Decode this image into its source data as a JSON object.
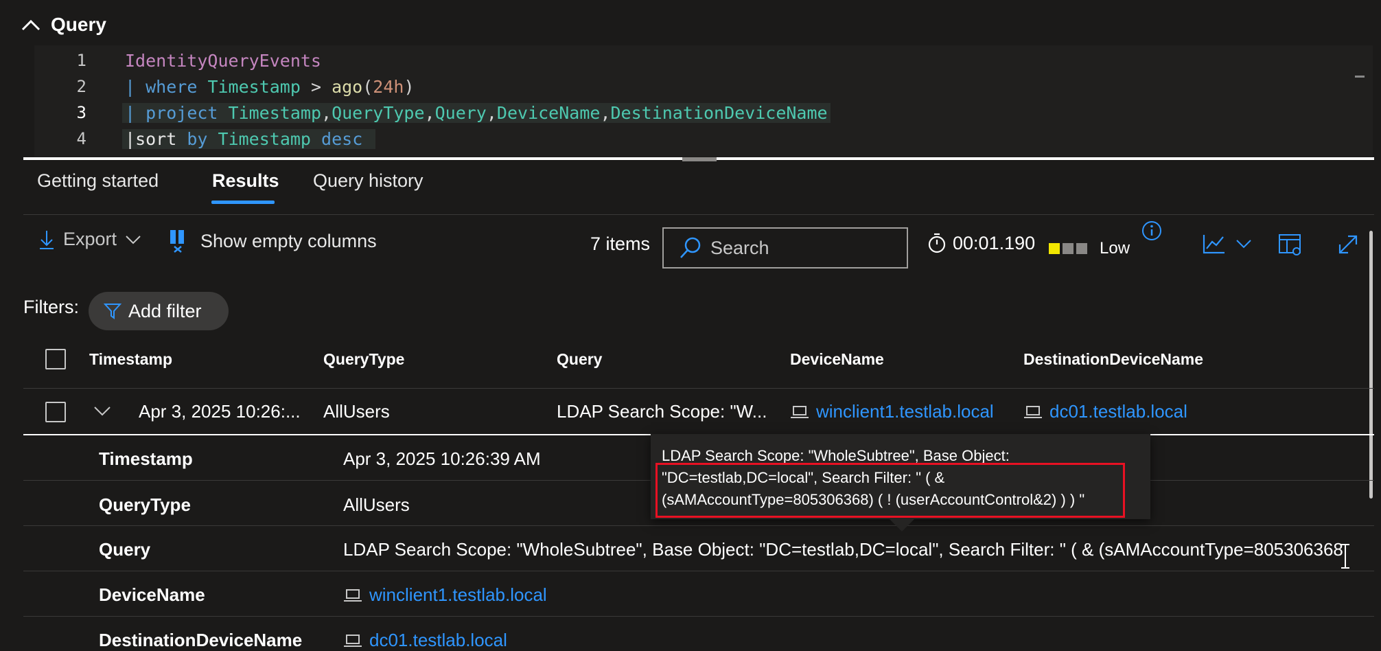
{
  "query_section": {
    "title": "Query",
    "editor": {
      "line_numbers": [
        "1",
        "2",
        "3",
        "4"
      ],
      "line1": {
        "table": "IdentityQueryEvents"
      },
      "line2": {
        "pipe": "| ",
        "kw": "where",
        "field": "Timestamp",
        "op": " > ",
        "fn": "ago",
        "open": "(",
        "num": "24h",
        "close": ")"
      },
      "line3": {
        "pipe": "| ",
        "kw": "project",
        "f1": "Timestamp",
        "f2": "QueryType",
        "f3": "Query",
        "f4": "DeviceName",
        "f5": "DestinationDeviceName",
        "comma": ","
      },
      "line4": {
        "pipe": "|",
        "kw": "sort",
        "by": "by",
        "field": "Timestamp",
        "dir": "desc"
      }
    }
  },
  "tabs": [
    {
      "label": "Getting started"
    },
    {
      "label": "Results",
      "active": true
    },
    {
      "label": "Query history"
    }
  ],
  "toolbar": {
    "export_label": "Export",
    "show_empty_label": "Show empty columns",
    "items_count": "7 items",
    "search_placeholder": "Search",
    "duration": "00:01.190",
    "usage_label": "Low",
    "usage_colors": [
      "#f2e600",
      "#8a8886",
      "#8a8886"
    ]
  },
  "filters": {
    "label": "Filters:",
    "add_filter_label": "Add filter"
  },
  "table": {
    "columns": [
      "Timestamp",
      "QueryType",
      "Query",
      "DeviceName",
      "DestinationDeviceName"
    ],
    "rows": [
      {
        "timestamp": "Apr 3, 2025 10:26:...",
        "query_type": "AllUsers",
        "query": "LDAP Search Scope: \"W...",
        "device_name": "winclient1.testlab.local",
        "destination_device_name": "dc01.testlab.local"
      }
    ]
  },
  "details": [
    {
      "key": "Timestamp",
      "value": "Apr 3, 2025 10:26:39 AM"
    },
    {
      "key": "QueryType",
      "value": "AllUsers"
    },
    {
      "key": "Query",
      "value": "LDAP Search Scope: \"WholeSubtree\", Base Object: \"DC=testlab,DC=local\", Search Filter: \" ( & (sAMAccountType=805306368"
    },
    {
      "key": "DeviceName",
      "value": "winclient1.testlab.local"
    },
    {
      "key": "DestinationDeviceName",
      "value": "dc01.testlab.local"
    }
  ],
  "tooltip": {
    "text": "LDAP Search Scope: \"WholeSubtree\", Base Object: \"DC=testlab,DC=local\", Search Filter: \" ( & (sAMAccountType=805306368) ( ! (userAccountControl&2) ) ) \""
  },
  "colors": {
    "background": "#1b1a19",
    "accent": "#2f96ff",
    "highlight": "#e81123"
  }
}
